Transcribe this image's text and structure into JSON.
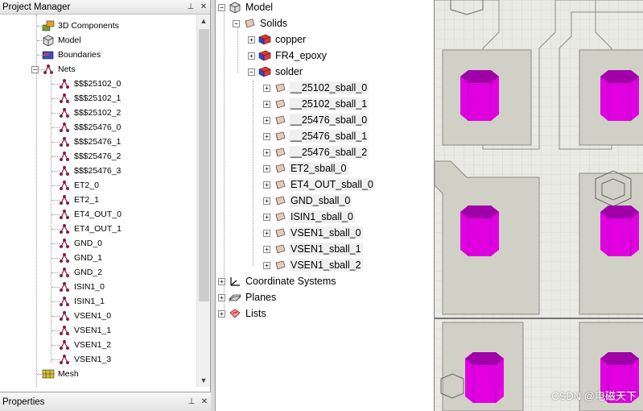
{
  "project_manager": {
    "title": "Project Manager",
    "items": [
      {
        "label": "3D Components",
        "icon": "components-icon"
      },
      {
        "label": "Model",
        "icon": "model-icon"
      },
      {
        "label": "Boundaries",
        "icon": "boundaries-icon"
      },
      {
        "label": "Nets",
        "icon": "nets-icon"
      },
      {
        "label": "$$$25102_0"
      },
      {
        "label": "$$$25102_1"
      },
      {
        "label": "$$$25102_2"
      },
      {
        "label": "$$$25476_0"
      },
      {
        "label": "$$$25476_1"
      },
      {
        "label": "$$$25476_2"
      },
      {
        "label": "$$$25476_3"
      },
      {
        "label": "ET2_0"
      },
      {
        "label": "ET2_1"
      },
      {
        "label": "ET4_OUT_0"
      },
      {
        "label": "ET4_OUT_1"
      },
      {
        "label": "GND_0"
      },
      {
        "label": "GND_1"
      },
      {
        "label": "GND_2"
      },
      {
        "label": "ISIN1_0"
      },
      {
        "label": "ISIN1_1"
      },
      {
        "label": "VSEN1_0"
      },
      {
        "label": "VSEN1_1"
      },
      {
        "label": "VSEN1_2"
      },
      {
        "label": "VSEN1_3"
      },
      {
        "label": "Mesh",
        "icon": "mesh-icon"
      }
    ]
  },
  "properties": {
    "title": "Properties"
  },
  "model_tree": {
    "root": "Model",
    "solids": "Solids",
    "materials": [
      "copper",
      "FR4_epoxy",
      "solder"
    ],
    "solder_items": [
      "__25102_sball_0",
      "__25102_sball_1",
      "__25476_sball_0",
      "__25476_sball_1",
      "__25476_sball_2",
      "ET2_sball_0",
      "ET4_OUT_sball_0",
      "GND_sball_0",
      "ISIN1_sball_0",
      "VSEN1_sball_0",
      "VSEN1_sball_1",
      "VSEN1_sball_2"
    ],
    "coordinate_systems": "Coordinate Systems",
    "planes": "Planes",
    "lists": "Lists"
  },
  "view": {
    "watermark": "CSDN @电磁天下",
    "ball_color": "#e000e0"
  },
  "colors": {
    "accent_copper": "#d02020",
    "accent_blue": "#2040d0",
    "net_color": "#8b1a4a"
  }
}
